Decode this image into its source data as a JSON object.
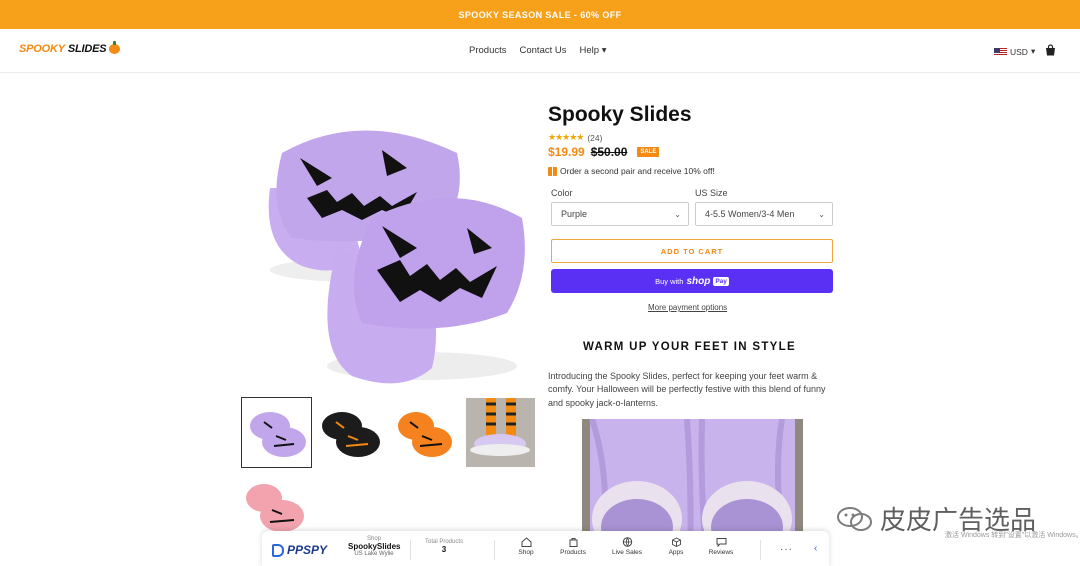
{
  "announcement": "SPOOKY SEASON SALE - 60% OFF",
  "header": {
    "logo_prefix": "SPOOKY",
    "logo_suffix": "SLIDES",
    "nav": [
      "Products",
      "Contact Us",
      "Help"
    ],
    "currency": "USD"
  },
  "product": {
    "title": "Spooky Slides",
    "stars": "★★★★★",
    "review_count": "(24)",
    "price": "$19.99",
    "compare_price": "$50.00",
    "badge": "SALE",
    "promo": "Order a second pair and receive 10% off!",
    "color_label": "Color",
    "color_value": "Purple",
    "size_label": "US Size",
    "size_value": "4-5.5 Women/3-4 Men",
    "add_to_cart": "ADD TO CART",
    "buy_with": "Buy with",
    "shop_brand": "shop",
    "pay_label": "Pay",
    "more_payment": "More payment options",
    "section_heading": "WARM UP YOUR FEET IN STYLE",
    "description": "Introducing the Spooky Slides, perfect for keeping your feet warm & comfy. Your Halloween will be perfectly festive with this blend of funny and spooky jack-o-lanterns.",
    "thumbnails": [
      "purple",
      "black",
      "orange",
      "lifestyle",
      "pink"
    ]
  },
  "ppspy": {
    "logo": "PPSPY",
    "shop_label": "Shop",
    "shop_name": "SpookySlides",
    "shop_location": "US Lake Wylie",
    "total_label": "Total Products",
    "total_value": "3",
    "tools": [
      "Shop",
      "Products",
      "Live Sales",
      "Apps",
      "Reviews"
    ]
  },
  "watermark": {
    "text": "皮皮广告选品",
    "sub": "激活 Windows 转到\"设置\"以激活 Windows。"
  },
  "colors": {
    "accent": "#f28a13",
    "announcement_bg": "#f7a01a",
    "shop_pay": "#5a31f4",
    "slipper_purple": "#c2a6ec"
  }
}
